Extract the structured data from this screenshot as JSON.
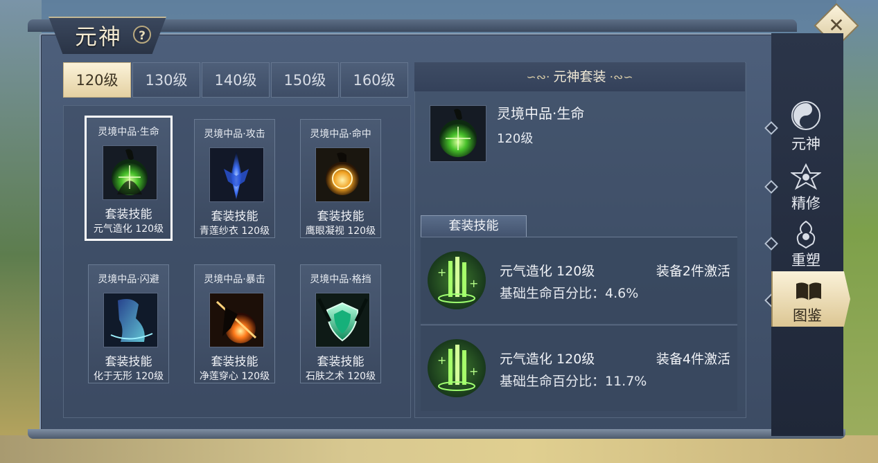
{
  "panel": {
    "title": "元神",
    "help_icon": "question-icon",
    "close_icon": "close-icon"
  },
  "tabs": [
    {
      "label": "120级",
      "active": true
    },
    {
      "label": "130级",
      "active": false
    },
    {
      "label": "140级",
      "active": false
    },
    {
      "label": "150级",
      "active": false
    },
    {
      "label": "160级",
      "active": false
    }
  ],
  "cards": [
    {
      "name": "灵境中品·生命",
      "skill_label": "套装技能",
      "skill_detail": "元气造化 120级",
      "icon": "green-orb-icon",
      "selected": true
    },
    {
      "name": "灵境中品·攻击",
      "skill_label": "套装技能",
      "skill_detail": "青莲纱衣 120级",
      "icon": "blue-sword-icon",
      "selected": false
    },
    {
      "name": "灵境中品·命中",
      "skill_label": "套装技能",
      "skill_detail": "鹰眼凝视 120级",
      "icon": "gold-ring-icon",
      "selected": false
    },
    {
      "name": "灵境中品·闪避",
      "skill_label": "套装技能",
      "skill_detail": "化于无形 120级",
      "icon": "blue-dash-icon",
      "selected": false
    },
    {
      "name": "灵境中品·暴击",
      "skill_label": "套装技能",
      "skill_detail": "净莲穿心 120级",
      "icon": "fire-strike-icon",
      "selected": false
    },
    {
      "name": "灵境中品·格挡",
      "skill_label": "套装技能",
      "skill_detail": "石肤之术 120级",
      "icon": "green-shield-icon",
      "selected": false
    }
  ],
  "detail": {
    "header": "元神套装",
    "set_name": "灵境中品·生命",
    "set_level": "120级",
    "skill_tab": "套装技能",
    "skills": [
      {
        "name": "元气造化 120级",
        "activation": "装备2件激活",
        "desc": "基础生命百分比：4.6%"
      },
      {
        "name": "元气造化 120级",
        "activation": "装备4件激活",
        "desc": "基础生命百分比：11.7%"
      }
    ]
  },
  "sidenav": [
    {
      "label": "元神",
      "icon": "yin-yang-icon",
      "active": false
    },
    {
      "label": "精修",
      "icon": "refine-icon",
      "active": false
    },
    {
      "label": "重塑",
      "icon": "reshape-icon",
      "active": false
    },
    {
      "label": "图鉴",
      "icon": "book-icon",
      "active": true
    }
  ],
  "colors": {
    "accent": "#e8d6a8",
    "panel": "#43546e",
    "skill_green": "#3e7a2e"
  }
}
